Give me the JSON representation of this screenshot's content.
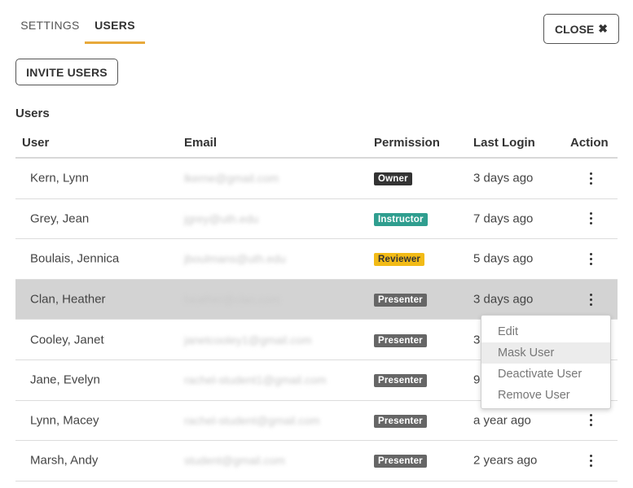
{
  "tabs": [
    {
      "label": "SETTINGS",
      "active": false
    },
    {
      "label": "USERS",
      "active": true
    }
  ],
  "close_button": {
    "label": "CLOSE",
    "icon": "close-icon",
    "glyph": "✖"
  },
  "invite_button": {
    "label": "INVITE USERS"
  },
  "section_title": "Users",
  "table": {
    "headers": {
      "user": "User",
      "email": "Email",
      "permission": "Permission",
      "last_login": "Last Login",
      "action": "Action"
    },
    "rows": [
      {
        "user": "Kern, Lynn",
        "email": "lkerne@gmail.com",
        "permission": "Owner",
        "last_login": "3 days ago"
      },
      {
        "user": "Grey, Jean",
        "email": "jgrey@uth.edu",
        "permission": "Instructor",
        "last_login": "7 days ago"
      },
      {
        "user": "Boulais, Jennica",
        "email": "jboulmans@uth.edu",
        "permission": "Reviewer",
        "last_login": "5 days ago"
      },
      {
        "user": "Clan, Heather",
        "email": "heather@clan.com",
        "permission": "Presenter",
        "last_login": "3 days ago"
      },
      {
        "user": "Cooley, Janet",
        "email": "janetcooley1@gmail.com",
        "permission": "Presenter",
        "last_login": "3"
      },
      {
        "user": "Jane, Evelyn",
        "email": "rachel-student1@gmail.com",
        "permission": "Presenter",
        "last_login": "9"
      },
      {
        "user": "Lynn, Macey",
        "email": "rachel-student@gmail.com",
        "permission": "Presenter",
        "last_login": "a year ago"
      },
      {
        "user": "Marsh, Andy",
        "email": "student@gmail.com",
        "permission": "Presenter",
        "last_login": "2 years ago"
      }
    ]
  },
  "action_menu": {
    "items": [
      "Edit",
      "Mask User",
      "Deactivate User",
      "Remove User"
    ],
    "hovered": "Mask User"
  },
  "colors": {
    "tab_underline": "#e8a93a",
    "owner_badge": "#333333",
    "instructor_badge": "#2f9e8f",
    "reviewer_badge": "#f2bb17",
    "presenter_badge": "#666666",
    "highlighted_row": "#d3d3d3"
  }
}
